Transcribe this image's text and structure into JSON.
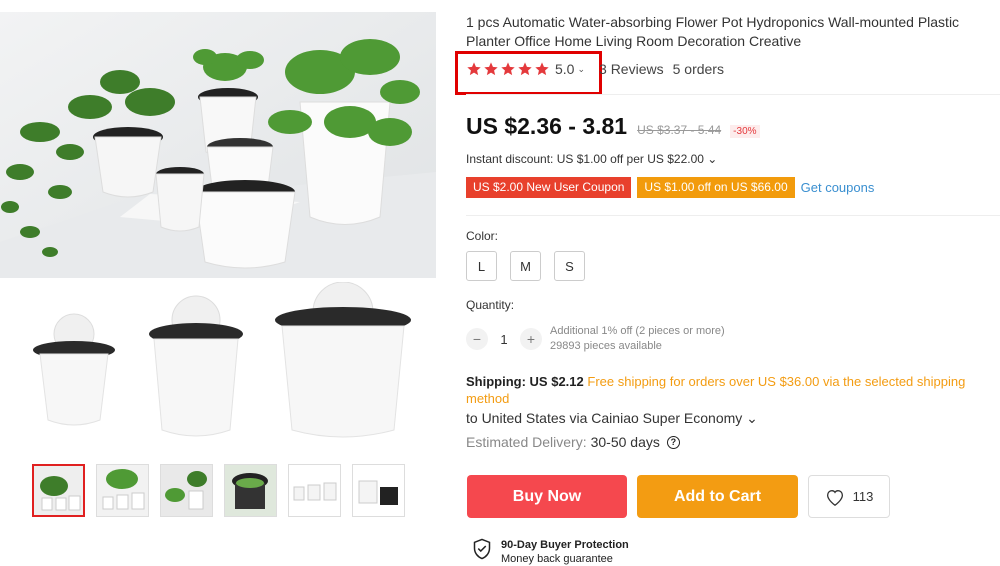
{
  "product": {
    "title": "1 pcs Automatic Water-absorbing Flower Pot Hydroponics Wall-mounted Plastic Planter Office Home Living Room Decoration Creative",
    "rating": "5.0",
    "reviews": "3 Reviews",
    "orders": "5 orders",
    "price": "US $2.36 - 3.81",
    "old_price": "US $3.37 - 5.44",
    "discount": "-30%",
    "instant_discount": "Instant discount: US $1.00 off per US $22.00 ⌄",
    "coupons": [
      "US $2.00 New User Coupon",
      "US $1.00 off on US $66.00"
    ],
    "get_coupons": "Get coupons",
    "color_label": "Color:",
    "sizes": [
      "L",
      "M",
      "S"
    ],
    "quantity_label": "Quantity:",
    "quantity": "1",
    "qty_discount": "Additional 1% off (2 pieces or more)",
    "qty_available": "29893 pieces available",
    "shipping_label": "Shipping: US $2.12",
    "shipping_free": "Free shipping for orders over US $36.00 via the selected shipping method",
    "ship_to": "to United States via Cainiao Super Economy ⌄",
    "delivery_label": "Estimated Delivery:",
    "delivery_value": "30-50 days",
    "buy_now": "Buy Now",
    "add_to_cart": "Add to Cart",
    "wishlist_count": "113",
    "protection_title": "90-Day Buyer Protection",
    "protection_sub": "Money back guarantee"
  },
  "colors": {
    "star": "#e4393c",
    "buy_now": "#f5484e",
    "add_to_cart": "#f39c12",
    "coupon_red": "#e8402c",
    "coupon_orange": "#f29b0c",
    "link": "#3a8fd0",
    "highlight": "#e00000"
  },
  "icons": [
    "star-icon",
    "heart-icon",
    "help-icon",
    "shield-check-icon",
    "chevron-down-icon"
  ]
}
